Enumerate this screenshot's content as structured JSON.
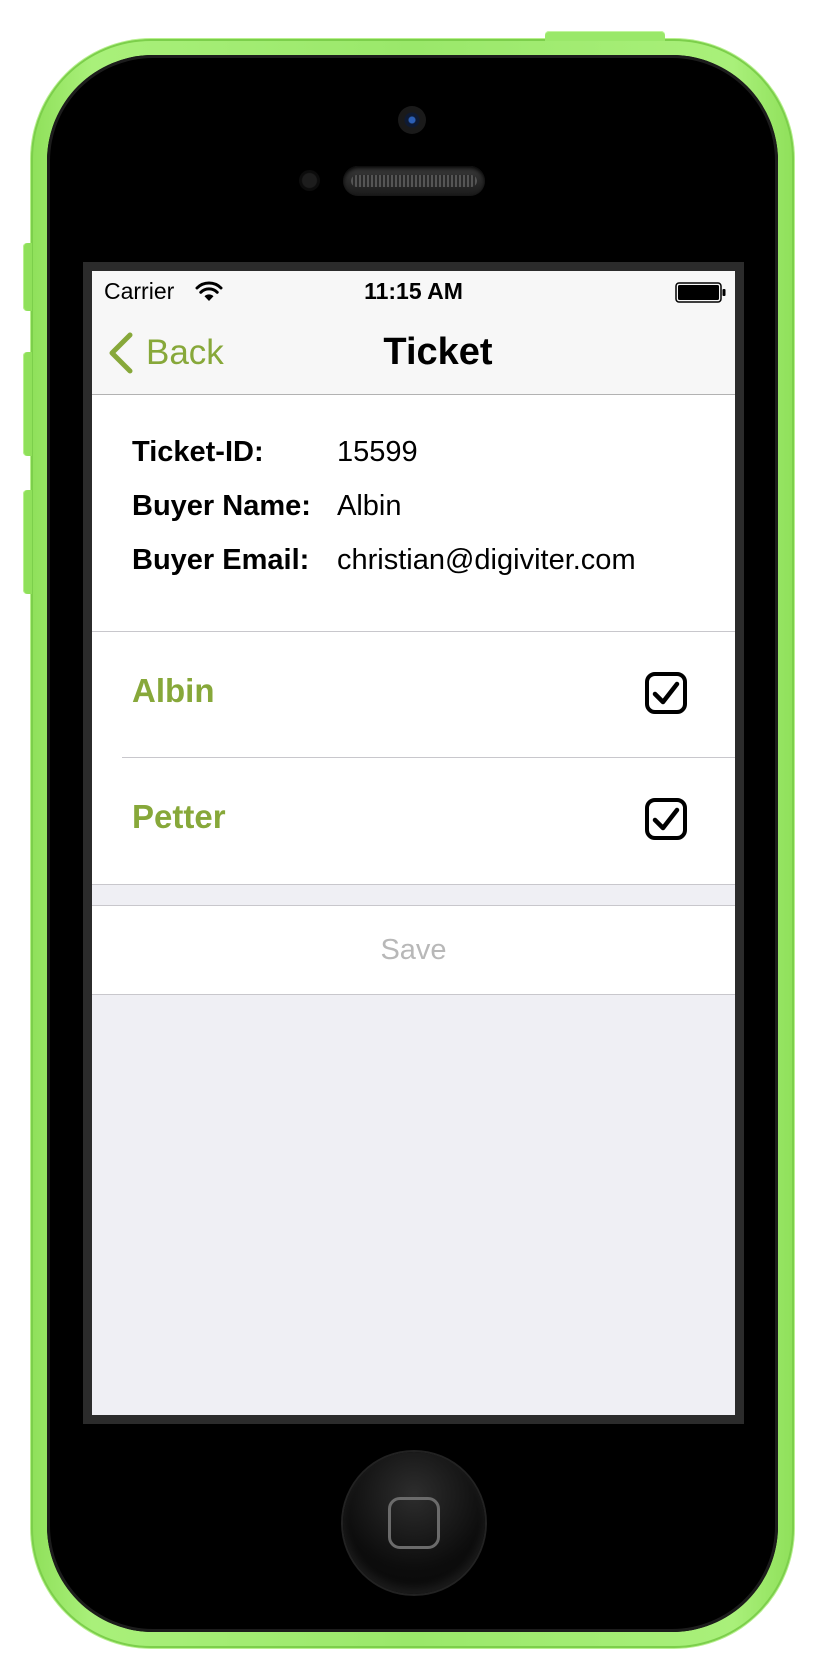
{
  "status_bar": {
    "carrier": "Carrier",
    "time": "11:15 AM"
  },
  "nav": {
    "back_label": "Back",
    "title": "Ticket"
  },
  "info": [
    {
      "label": "Ticket-ID:",
      "value": "15599"
    },
    {
      "label": "Buyer Name:",
      "value": "Albin"
    },
    {
      "label": "Buyer Email:",
      "value": "christian@digiviter.com"
    }
  ],
  "people": [
    {
      "name": "Albin",
      "checked": true
    },
    {
      "name": "Petter",
      "checked": true
    }
  ],
  "save_label": "Save",
  "colors": {
    "accent": "#87a83a",
    "phone_shell": "#9ae86a",
    "disabled_text": "#b8b8b8",
    "background_grouped": "#efeff4"
  },
  "icons": {
    "wifi": "wifi-icon",
    "battery": "battery-icon",
    "back": "chevron-left-icon",
    "checkbox": "checkbox-checked-icon"
  }
}
